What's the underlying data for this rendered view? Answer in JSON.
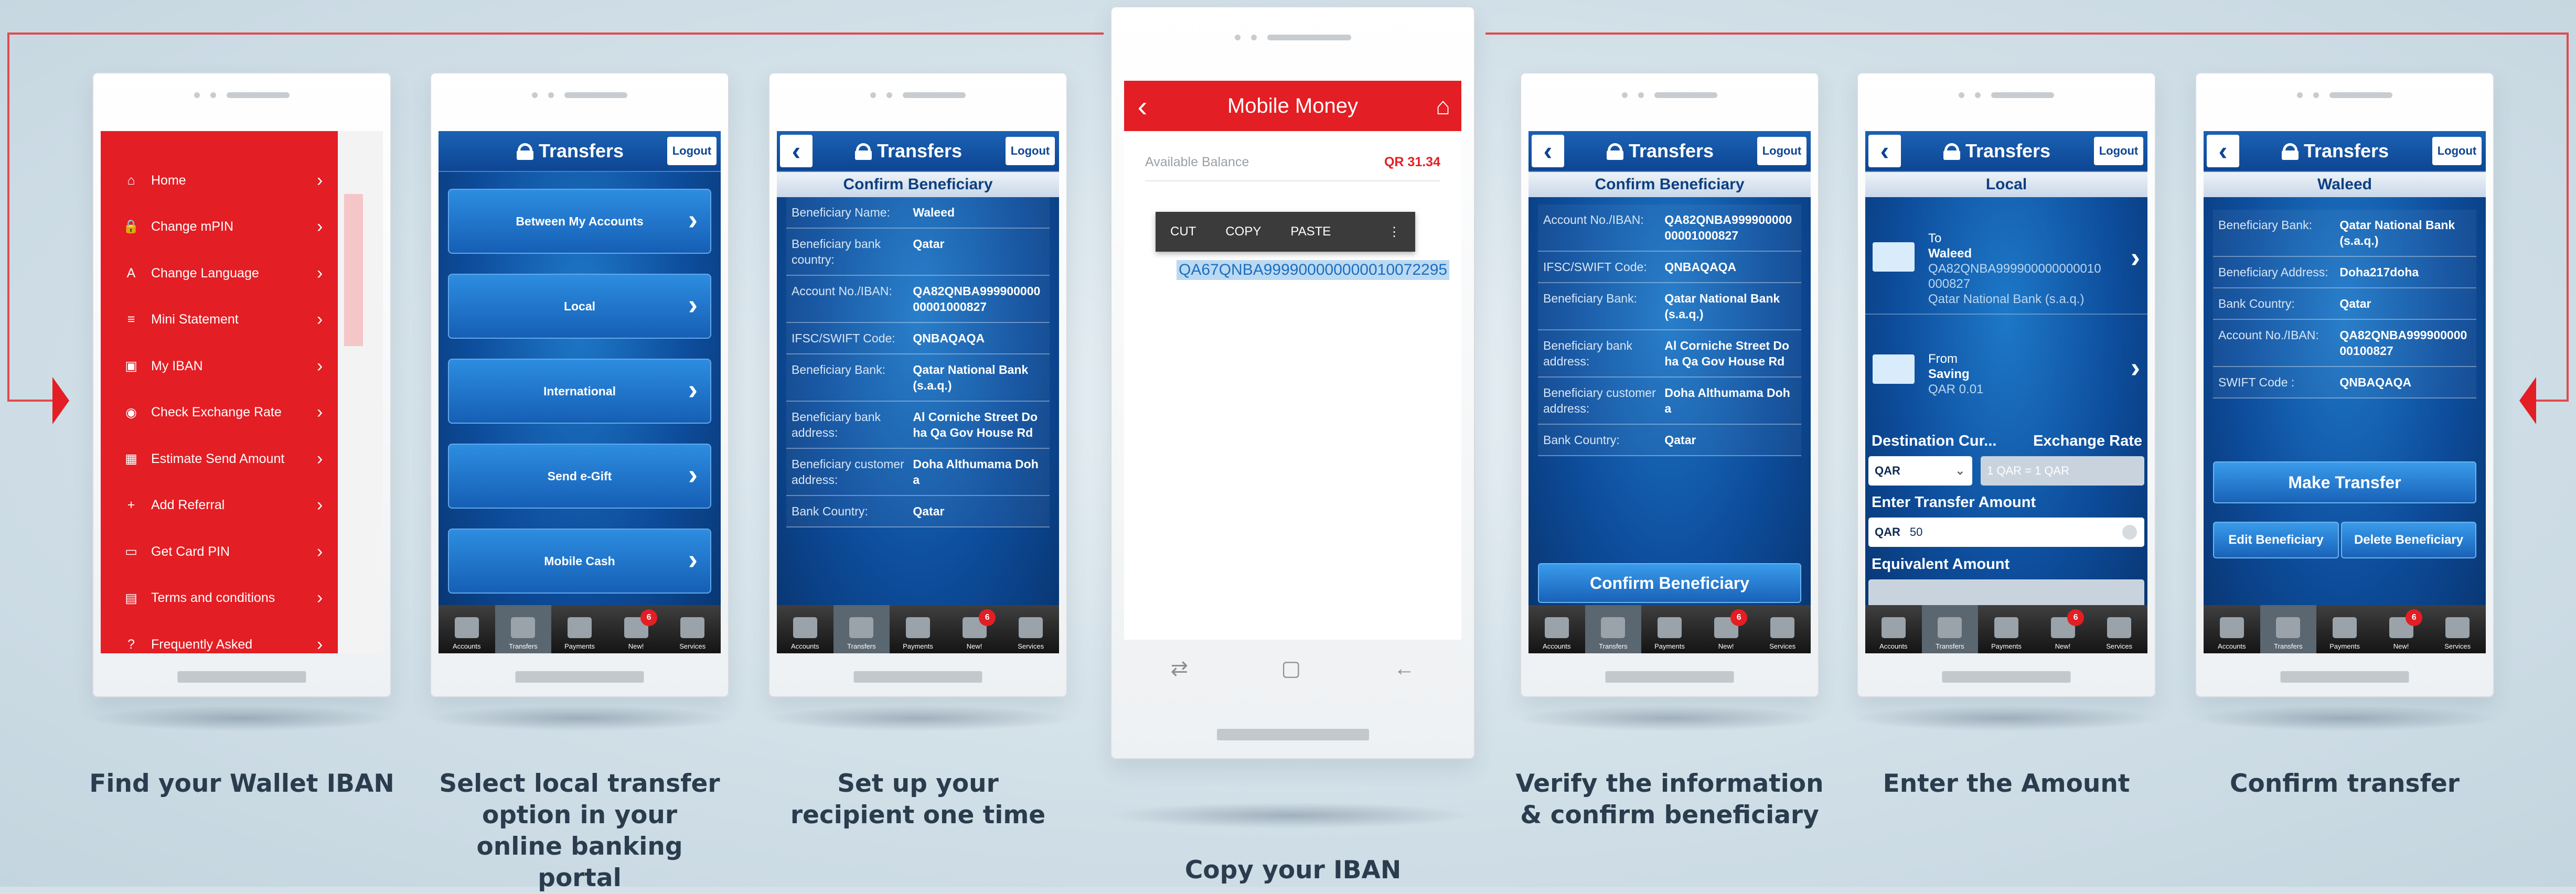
{
  "phone1": {
    "caption": "Find your Wallet IBAN",
    "menu": [
      {
        "icon": "home-icon",
        "label": "Home"
      },
      {
        "icon": "lock-icon",
        "label": "Change mPIN"
      },
      {
        "icon": "language-icon",
        "label": "Change Language"
      },
      {
        "icon": "statement-icon",
        "label": "Mini Statement"
      },
      {
        "icon": "wallet-icon",
        "label": "My IBAN"
      },
      {
        "icon": "exchange-icon",
        "label": "Check Exchange Rate"
      },
      {
        "icon": "calculator-icon",
        "label": "Estimate Send Amount"
      },
      {
        "icon": "add-user-icon",
        "label": "Add Referral"
      },
      {
        "icon": "card-icon",
        "label": "Get Card PIN"
      },
      {
        "icon": "document-icon",
        "label": "Terms and conditions"
      },
      {
        "icon": "help-icon",
        "label": "Frequently Asked"
      }
    ]
  },
  "phone2": {
    "caption": "Select local transfer option in your online banking portal",
    "title": "Transfers",
    "logout": "Logout",
    "options": [
      "Between My Accounts",
      "Local",
      "International",
      "Send e-Gift",
      "Mobile Cash"
    ]
  },
  "tabs": [
    "Accounts",
    "Transfers",
    "Payments",
    "New!",
    "Services"
  ],
  "tabs_badge": "6",
  "phone3": {
    "caption": "Set up your recipient one time",
    "title": "Transfers",
    "logout": "Logout",
    "subtitle": "Confirm Beneficiary",
    "rows": [
      {
        "k": "Beneficiary Name:",
        "v": "Waleed"
      },
      {
        "k": "Beneficiary bank country:",
        "v": "Qatar"
      },
      {
        "k": "Account No./IBAN:",
        "v": "QA82QNBA99990000000001000827"
      },
      {
        "k": "IFSC/SWIFT Code:",
        "v": "QNBAQAQA"
      },
      {
        "k": "Beneficiary Bank:",
        "v": "Qatar National Bank (s.a.q.)"
      },
      {
        "k": "Beneficiary bank address:",
        "v": "Al Corniche Street Doha Qa Gov House Rd"
      },
      {
        "k": "Beneficiary customer address:",
        "v": "Doha Althumama Doha"
      },
      {
        "k": "Bank Country:",
        "v": "Qatar"
      }
    ]
  },
  "phone4": {
    "caption": "Copy your IBAN",
    "title": "Mobile Money",
    "balance_label": "Available Balance",
    "balance_value": "QR 31.34",
    "context_menu": [
      "CUT",
      "COPY",
      "PASTE"
    ],
    "iban": "QA67QNBA999900000000010072295"
  },
  "phone5": {
    "caption": "Verify the information & confirm beneficiary",
    "title": "Transfers",
    "logout": "Logout",
    "subtitle": "Confirm Beneficiary",
    "rows": [
      {
        "k": "Account No./IBAN:",
        "v": "QA82QNBA99990000000001000827"
      },
      {
        "k": "IFSC/SWIFT Code:",
        "v": "QNBAQAQA"
      },
      {
        "k": "Beneficiary Bank:",
        "v": "Qatar National Bank (s.a.q.)"
      },
      {
        "k": "Beneficiary bank address:",
        "v": "Al Corniche Street Doha Qa Gov House Rd"
      },
      {
        "k": "Beneficiary customer address:",
        "v": "Doha Althumama Doha"
      },
      {
        "k": "Bank Country:",
        "v": "Qatar"
      }
    ],
    "confirm": "Confirm Beneficiary"
  },
  "phone6": {
    "caption": "Enter the Amount",
    "title": "Transfers",
    "logout": "Logout",
    "subtitle": "Local",
    "to_label": "To",
    "to_name": "Waleed",
    "to_iban": "QA82QNBA999900000000010000827",
    "to_bank": "Qatar National Bank (s.a.q.)",
    "from_label": "From",
    "from_name": "Saving",
    "from_amount": "QAR 0.01",
    "dest_label": "Destination Cur...",
    "rate_label": "Exchange Rate",
    "dest_value": "QAR",
    "rate_value": "1 QAR = 1 QAR",
    "amount_label": "Enter Transfer Amount",
    "amount_currency": "QAR",
    "amount_value": "50",
    "equiv_label": "Equivalent Amount"
  },
  "phone7": {
    "caption": "Confirm transfer",
    "title": "Transfers",
    "logout": "Logout",
    "subtitle": "Waleed",
    "rows": [
      {
        "k": "Beneficiary Bank:",
        "v": "Qatar National Bank (s.a.q.)"
      },
      {
        "k": "Beneficiary Address:",
        "v": "Doha217doha"
      },
      {
        "k": "Bank Country:",
        "v": "Qatar"
      },
      {
        "k": "Account No./IBAN:",
        "v": "QA82QNBA99990000000100827"
      },
      {
        "k": "SWIFT Code :",
        "v": "QNBAQAQA"
      }
    ],
    "make_transfer": "Make Transfer",
    "edit": "Edit Beneficiary",
    "delete": "Delete Beneficiary"
  },
  "colors": {
    "red": "#e31e24",
    "blue": "#0d4d9c",
    "flow": "#e14a4f"
  }
}
